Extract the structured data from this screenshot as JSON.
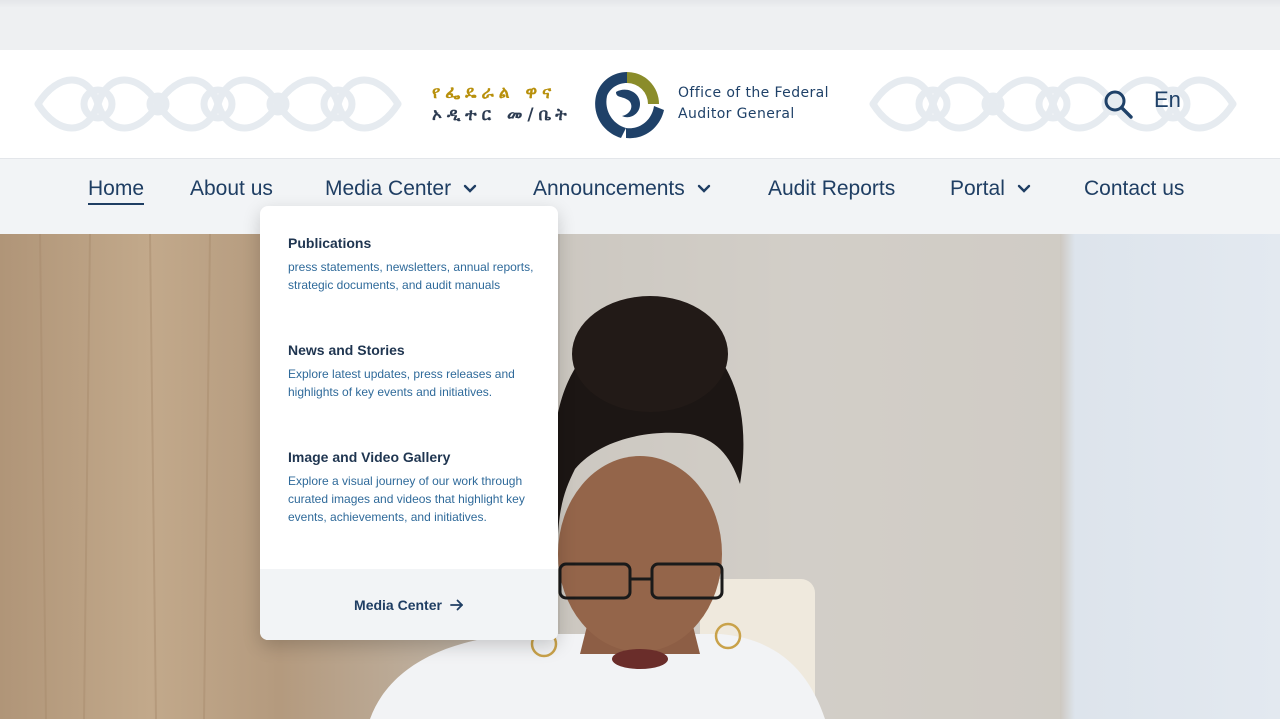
{
  "brand": {
    "amharic_line1": "የፌዴራል ዋና",
    "amharic_line2": "ኦዲተር መ/ቤት",
    "name_line1": "Office of the Federal",
    "name_line2": "Auditor General",
    "colors": {
      "navy": "#1f4168",
      "olive": "#8a8c2a",
      "gold": "#b8900c"
    }
  },
  "header": {
    "search_icon": "search-icon",
    "language": "En"
  },
  "nav": {
    "items": [
      {
        "label": "Home",
        "active": true
      },
      {
        "label": "About us"
      },
      {
        "label": "Media Center",
        "has_dropdown": true
      },
      {
        "label": "Announcements",
        "has_dropdown": true
      },
      {
        "label": "Audit Reports"
      },
      {
        "label": "Portal",
        "has_dropdown": true
      },
      {
        "label": "Contact us"
      }
    ]
  },
  "dropdown": {
    "items": [
      {
        "title": "Publications",
        "description": "press statements, newsletters, annual reports, strategic documents, and audit manuals"
      },
      {
        "title": "News and Stories",
        "description": "Explore latest updates, press releases and highlights of key events and initiatives."
      },
      {
        "title": "Image and Video Gallery",
        "description": "Explore a visual journey of our work through curated images and videos that highlight key events, achievements, and initiatives."
      }
    ],
    "footer_label": "Media Center",
    "footer_icon": "arrow-right-icon"
  },
  "hero": {
    "image": "person-at-podium-photo"
  }
}
